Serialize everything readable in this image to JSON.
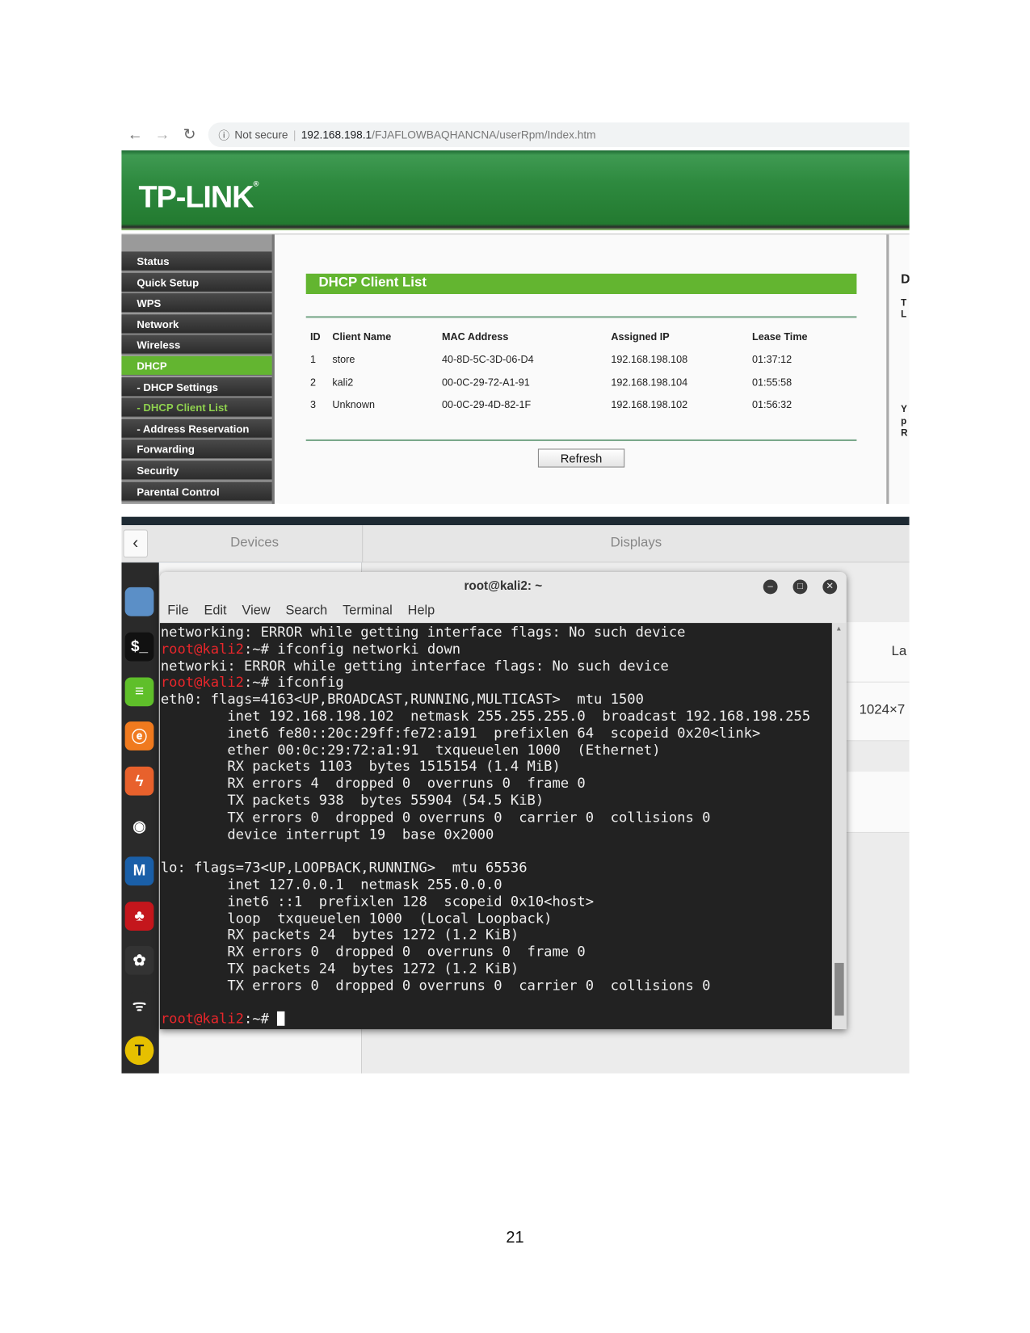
{
  "browser": {
    "security": "Not secure",
    "url_host": "192.168.198.1",
    "url_path": "/FJAFLOWBAQHANCNA/userRpm/Index.htm",
    "icons": [
      "back-arrow-icon",
      "forward-arrow-icon",
      "reload-icon",
      "info-icon"
    ]
  },
  "router": {
    "brand": "TP-LINK",
    "brand_color": "#2e8a3f",
    "accent": "#63b530",
    "menu": [
      {
        "label": "Status"
      },
      {
        "label": "Quick Setup"
      },
      {
        "label": "WPS"
      },
      {
        "label": "Network"
      },
      {
        "label": "Wireless"
      },
      {
        "label": "DHCP",
        "active": true
      },
      {
        "label": "- DHCP Settings"
      },
      {
        "label": "- DHCP Client List",
        "current": true
      },
      {
        "label": "- Address Reservation"
      },
      {
        "label": "Forwarding"
      },
      {
        "label": "Security"
      },
      {
        "label": "Parental Control"
      }
    ],
    "title": "DHCP Client List",
    "columns": [
      "ID",
      "Client Name",
      "MAC Address",
      "Assigned IP",
      "Lease Time"
    ],
    "rows": [
      [
        "1",
        "store",
        "40-8D-5C-3D-06-D4",
        "192.168.198.108",
        "01:37:12"
      ],
      [
        "2",
        "kali2",
        "00-0C-29-72-A1-91",
        "192.168.198.104",
        "01:55:58"
      ],
      [
        "3",
        "Unknown",
        "00-0C-29-4D-82-1F",
        "192.168.198.102",
        "01:56:32"
      ]
    ],
    "refresh_label": "Refresh",
    "help_fragments": [
      "D",
      "T",
      "L",
      "Y",
      "p",
      "R"
    ]
  },
  "settings": {
    "back": "‹",
    "devices": "Devices",
    "displays": "Displays",
    "frag1": "La",
    "frag2": "1024×7"
  },
  "terminal": {
    "title": "root@kali2: ~",
    "menu": [
      "File",
      "Edit",
      "View",
      "Search",
      "Terminal",
      "Help"
    ],
    "prompt_user": "root@kali2",
    "prompt_suffix": ":~# ",
    "lines": [
      {
        "text": "networking: ERROR while getting interface flags: No such device"
      },
      {
        "prompt": true,
        "text": "ifconfig networki down"
      },
      {
        "text": "networki: ERROR while getting interface flags: No such device"
      },
      {
        "prompt": true,
        "text": "ifconfig"
      },
      {
        "text": "eth0: flags=4163<UP,BROADCAST,RUNNING,MULTICAST>  mtu 1500"
      },
      {
        "text": "        inet 192.168.198.102  netmask 255.255.255.0  broadcast 192.168.198.255"
      },
      {
        "text": "        inet6 fe80::20c:29ff:fe72:a191  prefixlen 64  scopeid 0x20<link>"
      },
      {
        "text": "        ether 00:0c:29:72:a1:91  txqueuelen 1000  (Ethernet)"
      },
      {
        "text": "        RX packets 1103  bytes 1515154 (1.4 MiB)"
      },
      {
        "text": "        RX errors 4  dropped 0  overruns 0  frame 0"
      },
      {
        "text": "        TX packets 938  bytes 55904 (54.5 KiB)"
      },
      {
        "text": "        TX errors 0  dropped 0 overruns 0  carrier 0  collisions 0"
      },
      {
        "text": "        device interrupt 19  base 0x2000"
      },
      {
        "text": ""
      },
      {
        "text": "lo: flags=73<UP,LOOPBACK,RUNNING>  mtu 65536"
      },
      {
        "text": "        inet 127.0.0.1  netmask 255.0.0.0"
      },
      {
        "text": "        inet6 ::1  prefixlen 128  scopeid 0x10<host>"
      },
      {
        "text": "        loop  txqueuelen 1000  (Local Loopback)"
      },
      {
        "text": "        RX packets 24  bytes 1272 (1.2 KiB)"
      },
      {
        "text": "        RX errors 0  dropped 0  overruns 0  frame 0"
      },
      {
        "text": "        TX packets 24  bytes 1272 (1.2 KiB)"
      },
      {
        "text": "        TX errors 0  dropped 0 overruns 0  carrier 0  collisions 0"
      },
      {
        "text": ""
      },
      {
        "prompt": true,
        "text": "",
        "cursor": true
      }
    ],
    "prompt_color": "#e8262b"
  },
  "page_number": "21"
}
